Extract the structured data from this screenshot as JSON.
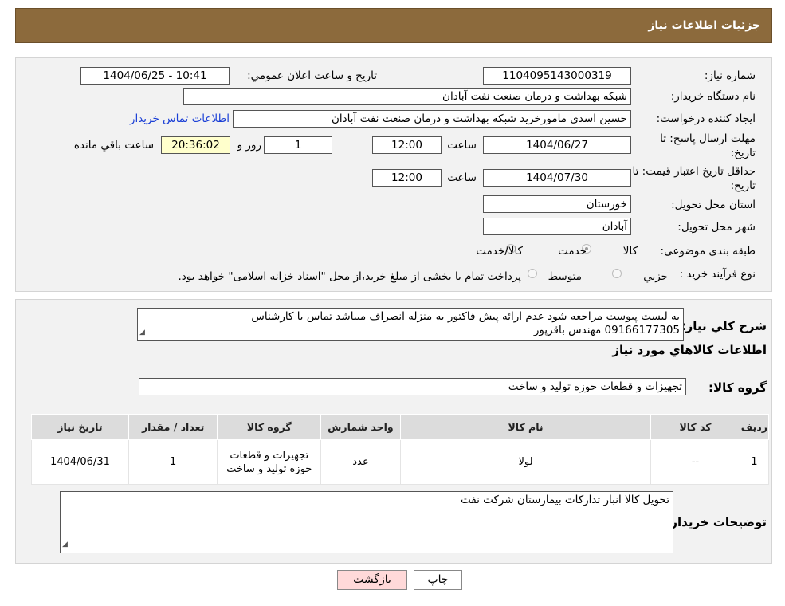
{
  "header": {
    "title": "جزئیات اطلاعات نیاز"
  },
  "form": {
    "need_number_label": "شماره نیاز:",
    "need_number": "1104095143000319",
    "announce_label": "تاریخ و ساعت اعلان عمومي:",
    "announce_value": "1404/06/25 - 10:41",
    "buyer_org_label": "نام دستگاه خريدار:",
    "buyer_org": "شبکه بهداشت و درمان صنعت نفت آبادان",
    "creator_label": "ايجاد کننده درخواست:",
    "creator": "حسین اسدی مامورخرید شبکه بهداشت و درمان صنعت نفت آبادان",
    "contact_link": "اطلاعات تماس خريدار",
    "reply_deadline_label": "مهلت ارسال پاسخ: تا تاریخ:",
    "reply_date": "1404/06/27",
    "time_label": "ساعت",
    "reply_time": "12:00",
    "days_value": "1",
    "days_label": "روز و",
    "remaining_time": "20:36:02",
    "remaining_label": "ساعت باقي مانده",
    "validity_label": "حداقل تاریخ اعتبار قیمت: تا تاریخ:",
    "validity_date": "1404/07/30",
    "validity_time": "12:00",
    "province_label": "استان محل تحویل:",
    "province": "خوزستان",
    "city_label": "شهر محل تحویل:",
    "city": "آبادان",
    "category_label": "طبقه بندی موضوعی:",
    "category_options": [
      "کالا",
      "خدمت",
      "کالا/خدمت"
    ],
    "process_label": "نوع فرآیند خرید :",
    "process_options": [
      "جزيي",
      "متوسط"
    ],
    "process_note": "پرداخت تمام یا بخشی از مبلغ خرید،از محل \"اسناد خزانه اسلامی\" خواهد بود."
  },
  "details": {
    "summary_label": "شرح کلي نیاز:",
    "summary_line1": "به لیست پیوست مراجعه شود عدم ارائه پیش فاکتور به منزله انصراف میباشد تماس با کارشناس",
    "summary_line2": "09166177305 مهندس باقرپور",
    "goods_info_title": "اطلاعات کالاهاي مورد نياز",
    "goods_group_label": "گروه کالا:",
    "goods_group": "تجهیزات و قطعات حوزه تولید و ساخت",
    "table": {
      "headers": [
        "رديف",
        "کد کالا",
        "نام کالا",
        "واحد شمارش",
        "گروه کالا",
        "تعداد / مقدار",
        "تاریخ نیاز"
      ],
      "rows": [
        [
          "1",
          "--",
          "لولا",
          "عدد",
          "تجهیزات و قطعات حوزه تولید و ساخت",
          "1",
          "1404/06/31"
        ]
      ]
    },
    "buyer_notes_label": "توضيحات خريدار:",
    "buyer_notes": "تحویل کالا انبار تدارکات بیمارستان شرکت نفت"
  },
  "buttons": {
    "print": "چاپ",
    "back": "بازگشت"
  },
  "colors": {
    "header_bg": "#8c6a3c",
    "link": "#1a3fd6",
    "remaining_bg": "#ffffcc",
    "back_bg": "#ffd9d9"
  }
}
